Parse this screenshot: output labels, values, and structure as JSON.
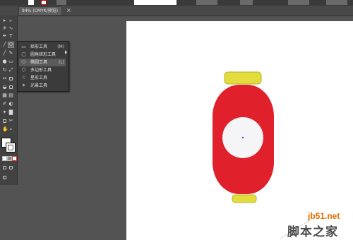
{
  "document": {
    "tab_label": "94% (CMYK/预览)",
    "close_glyph": "×"
  },
  "tools_flyout": {
    "items": [
      {
        "icon": "rectangle-icon",
        "label": "矩形工具",
        "shortcut": "(M)"
      },
      {
        "icon": "rounded-rectangle-icon",
        "label": "圆角矩形工具",
        "shortcut": ""
      },
      {
        "icon": "ellipse-icon",
        "label": "椭圆工具",
        "shortcut": "(L)"
      },
      {
        "icon": "polygon-icon",
        "label": "多边形工具",
        "shortcut": ""
      },
      {
        "icon": "star-icon",
        "label": "星形工具",
        "shortcut": ""
      },
      {
        "icon": "flare-icon",
        "label": "光晕工具",
        "shortcut": ""
      }
    ],
    "selected_index": 2
  },
  "colors": {
    "lantern_body": "#e0202a",
    "lantern_caps": "#e2dc3c",
    "lantern_window": "#f5f5f8",
    "anchor_point": "#4b5ad0",
    "watermark_url": "#e07000"
  },
  "watermark": {
    "url": "jb51.net",
    "name": "脚本之家"
  }
}
